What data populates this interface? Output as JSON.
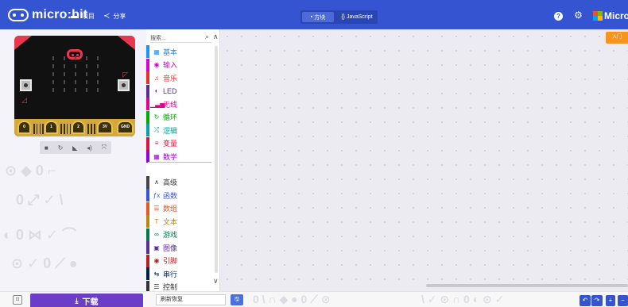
{
  "header": {
    "logo_text": "micro:bit",
    "projects_label": "项目",
    "share_label": "分享",
    "toggle": {
      "blocks_label": "方块",
      "js_label": "{} JavaScript",
      "active": "blocks"
    },
    "help_glyph": "?",
    "brand_text": "Microsoft",
    "icons": [
      "microbit-logo-icon",
      "folder-icon",
      "share-icon",
      "help-icon",
      "gear-icon",
      "microsoft-logo-icon"
    ]
  },
  "simulator": {
    "pins": [
      "0",
      "1",
      "2",
      "3V",
      "GND"
    ],
    "button_labels": [
      "A",
      "B"
    ],
    "toolbar": [
      "stop-icon",
      "restart-icon",
      "slowmo-icon",
      "mute-icon",
      "fullscreen-icon"
    ]
  },
  "toolbox": {
    "search_placeholder": "搜索...",
    "categories": [
      {
        "label": "基本",
        "icon": "grid-icon",
        "glyph": "▦",
        "color": "#1e90ff"
      },
      {
        "label": "输入",
        "icon": "input-icon",
        "glyph": "◉",
        "color": "#d400d4"
      },
      {
        "label": "音乐",
        "icon": "headphones-icon",
        "glyph": "♫",
        "color": "#e63022"
      },
      {
        "label": "LED",
        "icon": "toggle-icon",
        "glyph": "◐",
        "color": "#5c2d91"
      },
      {
        "label": "无线",
        "icon": "signal-icon",
        "glyph": "▁▃▅",
        "color": "#e3008c"
      },
      {
        "label": "循环",
        "icon": "loop-icon",
        "glyph": "↻",
        "color": "#00aa00"
      },
      {
        "label": "逻辑",
        "icon": "shuffle-icon",
        "glyph": "⤮",
        "color": "#00a4a6"
      },
      {
        "label": "变量",
        "icon": "list-icon",
        "glyph": "≡",
        "color": "#dc143c"
      },
      {
        "label": "数学",
        "icon": "calculator-icon",
        "glyph": "▦",
        "color": "#9400d3"
      },
      {
        "label": "高级",
        "icon": "chevron-up-icon",
        "glyph": "∧",
        "color": "#444444"
      },
      {
        "label": "函数",
        "icon": "function-icon",
        "glyph": "ƒx",
        "color": "#3455db"
      },
      {
        "label": "数组",
        "icon": "array-icon",
        "glyph": "☰",
        "color": "#e65722"
      },
      {
        "label": "文本",
        "icon": "text-icon",
        "glyph": "T",
        "color": "#b8860b"
      },
      {
        "label": "游戏",
        "icon": "gamepad-icon",
        "glyph": "∞",
        "color": "#007a4b"
      },
      {
        "label": "图像",
        "icon": "image-icon",
        "glyph": "▣",
        "color": "#5c2d91"
      },
      {
        "label": "引脚",
        "icon": "pin-icon",
        "glyph": "◉",
        "color": "#b22222"
      },
      {
        "label": "串行",
        "icon": "usb-icon",
        "glyph": "⇆",
        "color": "#002050"
      },
      {
        "label": "控制",
        "icon": "control-icon",
        "glyph": "☰",
        "color": "#333333"
      }
    ]
  },
  "workspace": {
    "tutorial_label": "入门"
  },
  "footer": {
    "download_label": "下载",
    "project_name": "刷新恢复",
    "save_glyph": "🖫"
  },
  "colors": {
    "header_bg": "#3454d1",
    "download_bg": "#6c3ec7",
    "board_red": "#e8384f",
    "tutorial_orange": "#f7941d"
  }
}
